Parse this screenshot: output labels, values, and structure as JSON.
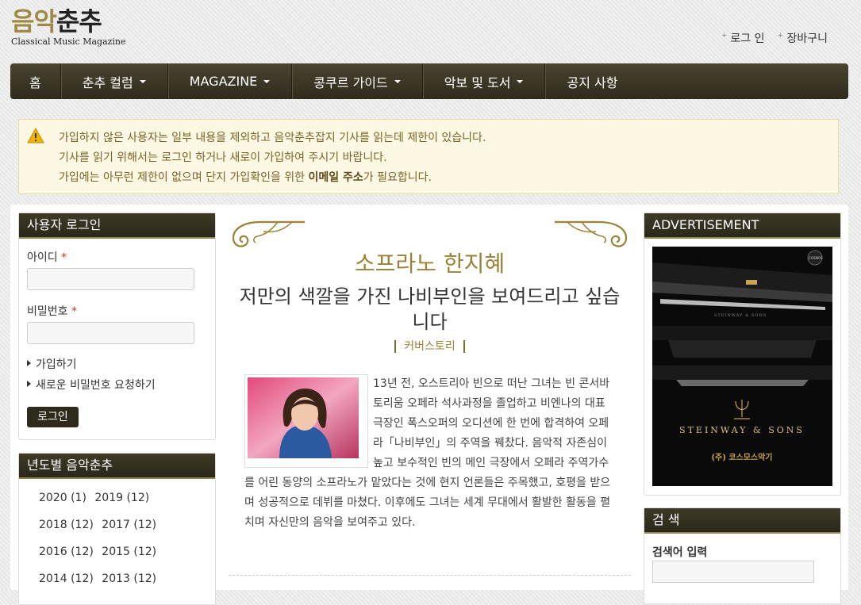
{
  "logo": {
    "word_part1": "음악",
    "word_part2": "춘추",
    "subtitle": "Classical Music Magazine"
  },
  "top_links": {
    "login": "로그 인",
    "cart": "장바구니"
  },
  "nav": {
    "items": [
      {
        "label": "홈",
        "dropdown": false
      },
      {
        "label": "춘추 컬럼",
        "dropdown": true
      },
      {
        "label": "MAGAZINE",
        "dropdown": true
      },
      {
        "label": "콩쿠르 가이드",
        "dropdown": true
      },
      {
        "label": "악보 및 도서",
        "dropdown": true
      },
      {
        "label": "공지 사항",
        "dropdown": false
      }
    ]
  },
  "notice": {
    "line1": "가입하지 않은 사용자는 일부 내용을 제외하고 음악춘추잡지 기사를 읽는데 제한이 있습니다.",
    "line2": "기사를 읽기 위해서는 로그인 하거나 새로이 가입하여 주시기 바랍니다.",
    "line3_pre": "가입에는 아무런 제한이 없으며 단지 가입확인을 위한 ",
    "line3_bold": "이메일 주소",
    "line3_post": "가 필요합니다."
  },
  "login_panel": {
    "title": "사용자 로그인",
    "id_label": "아이디",
    "pw_label": "비밀번호",
    "required_mark": "*",
    "signup_link": "가입하기",
    "reset_link": "새로운 비밀번호 요청하기",
    "submit": "로그인"
  },
  "year_panel": {
    "title": "년도별 음악춘추",
    "rows": [
      [
        "2020 (1)",
        "2019 (12)"
      ],
      [
        "2018 (12)",
        "2017 (12)"
      ],
      [
        "2016 (12)",
        "2015 (12)"
      ],
      [
        "2014 (12)",
        "2013 (12)"
      ]
    ]
  },
  "article": {
    "kicker": "소프라노 한지혜",
    "title": "저만의 색깔을 가진 나비부인을 보여드리고 싶습니다",
    "category": "커버스토리",
    "body": "13년 전, 오스트리아 빈으로 떠난 그녀는 빈 콘서바토리움 오페라 석사과정을 졸업하고 비엔나의 대표극장인 폭스오퍼의 오디션에 한 번에 합격하여 오페라「나비부인」의 주역을 꿰찼다. 음악적 자존심이 높고 보수적인 빈의 메인 극장에서 오페라 주역가수를 어린 동양의 소프라노가 맡았다는 것에 현지 언론들은 주목했고, 호평을 받으며 성공적으로 데뷔를 마쳤다. 이후에도 그녀는 세계 무대에서 활발한 활동을 펼치며 자신만의 음악을 보여주고 있다."
  },
  "ad_panel": {
    "title": "ADVERTISEMENT",
    "brand": "STEINWAY & SONS",
    "dealer": "(주) 코스모스악기",
    "piano_text": "STEINWAY & SONS",
    "badge": "COSMOS"
  },
  "search_panel": {
    "title": "검 색",
    "label": "검색어 입력"
  },
  "colors": {
    "nav_bg": "#2f2b1c",
    "accent_gold": "#9a8236",
    "notice_bg": "#fcf8e3"
  }
}
